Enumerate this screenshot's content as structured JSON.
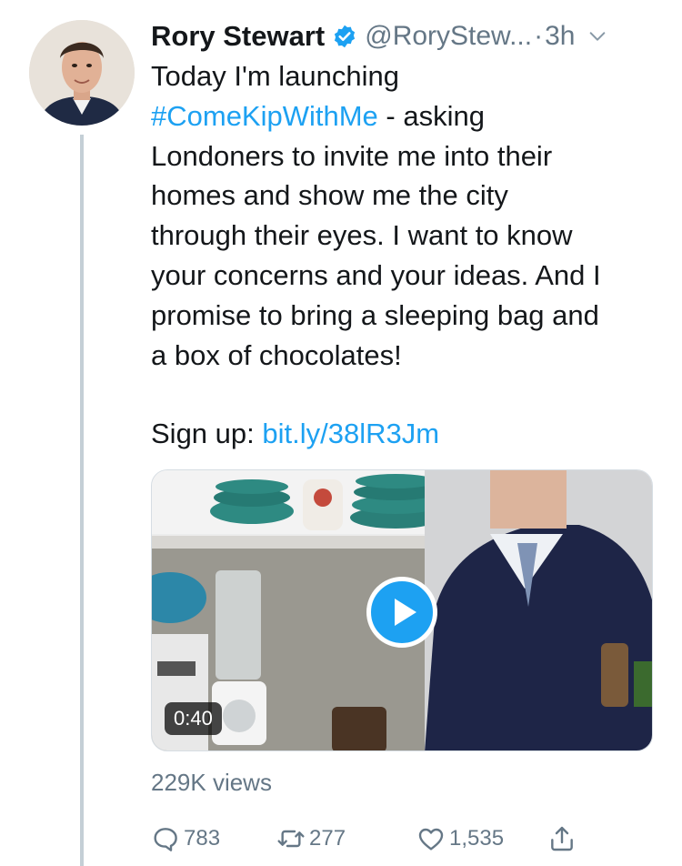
{
  "tweet": {
    "author_name": "Rory Stewart",
    "handle": "@RoryStew...",
    "separator": "·",
    "time": "3h",
    "body_lines": [
      {
        "text": "Today I'm launching",
        "link": ""
      },
      {
        "text": "",
        "link": "#ComeKipWithMe",
        "rest": " - asking"
      },
      {
        "text": "Londoners to invite me into their",
        "link": ""
      },
      {
        "text": "homes and show me the city",
        "link": ""
      },
      {
        "text": "through their eyes. I want to know",
        "link": ""
      },
      {
        "text": "your concerns and your ideas. And I",
        "link": ""
      },
      {
        "text": "promise to bring a sleeping bag and",
        "link": ""
      },
      {
        "text": "a box of chocolates!",
        "link": ""
      }
    ],
    "hashtag": "#ComeKipWithMe",
    "hashtag_rest": " - asking",
    "signup_label": "Sign up: ",
    "signup_link": "bit.ly/38lR3Jm",
    "video": {
      "duration": "0:40",
      "views": "229K views"
    },
    "actions": {
      "replies": "783",
      "retweets": "277",
      "likes": "1,535"
    }
  },
  "colors": {
    "link": "#1da1f2",
    "muted": "#657786",
    "text": "#14171a",
    "thread_line": "#c4cfd6"
  },
  "icons": [
    "verified-badge-icon",
    "chevron-down-icon",
    "play-icon",
    "reply-icon",
    "retweet-icon",
    "like-icon",
    "share-icon"
  ]
}
